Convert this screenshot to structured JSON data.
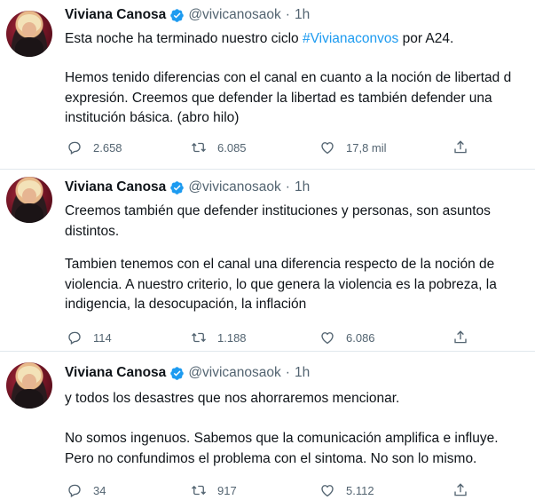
{
  "tweets": [
    {
      "name": "Viviana Canosa",
      "handle": "@vivicanosaok",
      "time": "1h",
      "lines": [
        "Esta noche ha terminado nuestro ciclo ",
        "Hemos tenido diferencias con el canal en cuanto a la noción de libertad d",
        "expresión. Creemos que defender la libertad es también defender una",
        "institución básica. (abro hilo)"
      ],
      "hashtag": "#Vivianaconvos",
      "after_hashtag": " por A24.",
      "stats": {
        "replies": "2.658",
        "retweets": "6.085",
        "likes": "17,8 mil"
      }
    },
    {
      "name": "Viviana Canosa",
      "handle": "@vivicanosaok",
      "time": "1h",
      "lines": [
        "Creemos también que defender instituciones y  personas, son asuntos",
        "distintos.",
        "Tambien tenemos con el canal una diferencia respecto de la noción de",
        "violencia. A nuestro criterio, lo que genera la violencia es la pobreza, la",
        "indigencia, la desocupación, la inflación"
      ],
      "stats": {
        "replies": "114",
        "retweets": "1.188",
        "likes": "6.086"
      }
    },
    {
      "name": "Viviana Canosa",
      "handle": "@vivicanosaok",
      "time": "1h",
      "lines": [
        "y todos los desastres que nos ahorraremos mencionar.",
        "No somos ingenuos. Sabemos que la comunicación amplifica e influye.",
        "Pero no confundimos el problema con el sintoma. No son lo mismo."
      ],
      "stats": {
        "replies": "34",
        "retweets": "917",
        "likes": "5.112"
      }
    }
  ],
  "separator": "·",
  "colors": {
    "text": "#0f1419",
    "secondary": "#536471",
    "link": "#1d9bf0",
    "verified": "#1d9bf0"
  },
  "icons": [
    "reply-icon",
    "retweet-icon",
    "like-icon",
    "share-icon",
    "verified-badge-icon"
  ]
}
